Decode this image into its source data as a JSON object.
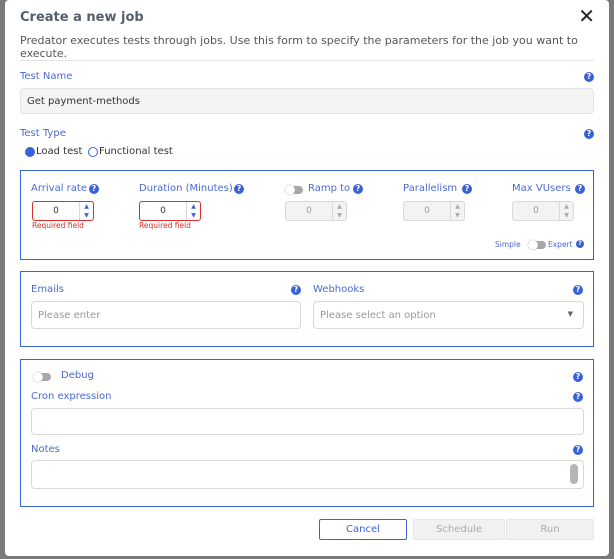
{
  "dialog": {
    "title": "Create a new job",
    "subtitle": "Predator executes tests through jobs. Use this form to specify the parameters for the job you want to execute."
  },
  "test_name": {
    "label": "Test Name",
    "value": "Get payment-methods"
  },
  "test_type": {
    "label": "Test Type",
    "options": [
      "Load test",
      "Functional test"
    ],
    "selected": "Load test"
  },
  "load": {
    "arrival_rate": {
      "label": "Arrival rate",
      "value": "0",
      "error": "Required field"
    },
    "duration": {
      "label": "Duration (Minutes)",
      "value": "0",
      "error": "Required field"
    },
    "ramp_to": {
      "label": "Ramp to",
      "value": "0"
    },
    "parallelism": {
      "label": "Parallelism",
      "value": "0"
    },
    "max_vusers": {
      "label": "Max VUsers",
      "value": "0"
    },
    "mode_simple": "Simple",
    "mode_expert": "Expert"
  },
  "notify": {
    "emails_label": "Emails",
    "emails_placeholder": "Please enter",
    "webhooks_label": "Webhooks",
    "webhooks_placeholder": "Please select an option"
  },
  "advanced": {
    "debug_label": "Debug",
    "cron_label": "Cron expression",
    "cron_value": "",
    "notes_label": "Notes",
    "notes_value": ""
  },
  "footer": {
    "cancel": "Cancel",
    "schedule": "Schedule",
    "run": "Run"
  },
  "colors": {
    "accent": "#3a62d7",
    "error": "#d8302b"
  }
}
